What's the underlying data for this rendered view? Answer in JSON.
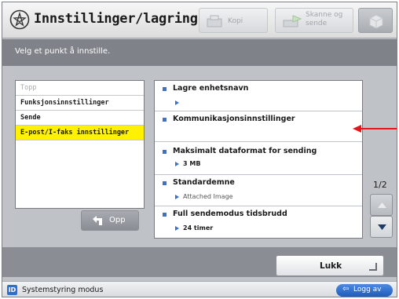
{
  "header": {
    "title": "Innstillinger/lagring",
    "tabs": [
      {
        "label": "Kopi",
        "icon": "copy-icon"
      },
      {
        "label": "Skanne og sende",
        "icon": "scan-send-icon"
      }
    ],
    "status_icon": "cube-icon"
  },
  "instruction": "Velg et punkt å innstille.",
  "left_list": {
    "items": [
      {
        "label": "Topp",
        "state": "dim"
      },
      {
        "label": "Funksjonsinnstillinger",
        "state": "normal"
      },
      {
        "label": "Sende",
        "state": "normal"
      },
      {
        "label": "E-post/I-faks innstillinger",
        "state": "selected"
      }
    ],
    "up_button": "Opp"
  },
  "settings": [
    {
      "name": "Lagre enhetsnavn",
      "value": ""
    },
    {
      "name": "Kommunikasjonsinnstillinger",
      "value": ""
    },
    {
      "name": "Maksimalt dataformat for sending",
      "value": "3 MB"
    },
    {
      "name": "Standardemne",
      "value": "Attached Image"
    },
    {
      "name": "Full sendemodus tidsbrudd",
      "value": "24 timer"
    }
  ],
  "pagination": "1/2",
  "close_button": "Lukk",
  "status_bar": {
    "mode_icon": "ID",
    "mode_text": "Systemstyring modus",
    "logout_label": "Logg av"
  },
  "colors": {
    "selection": "#fff200",
    "accent": "#3a72c8",
    "annotation_arrow": "#e8141b"
  }
}
